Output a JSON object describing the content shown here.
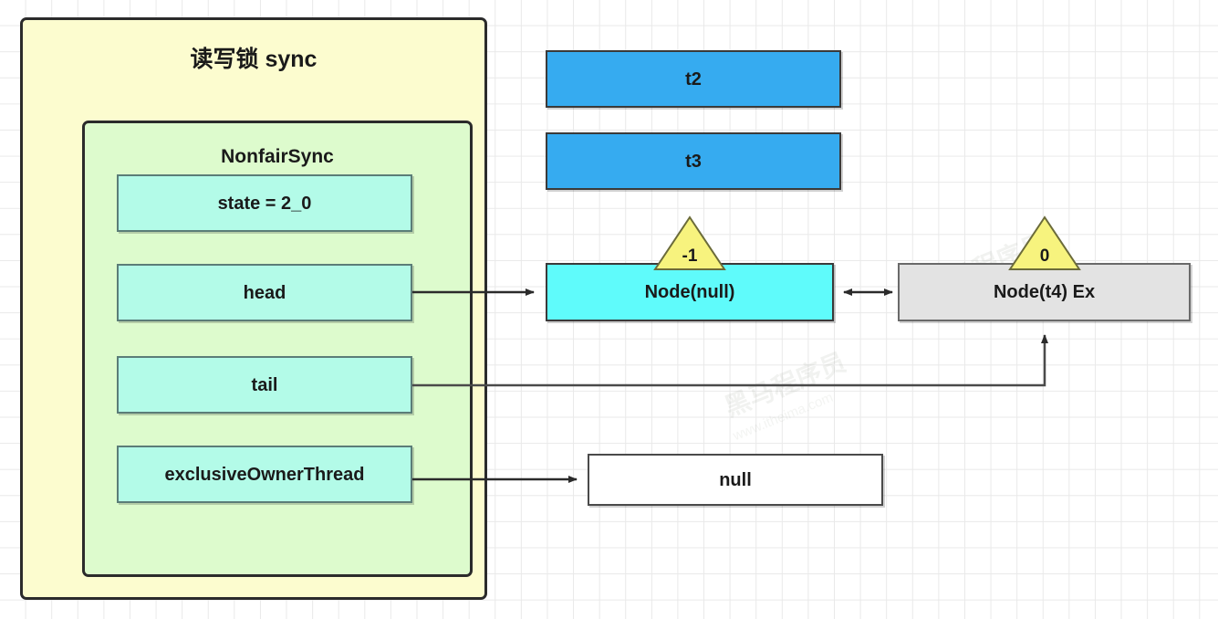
{
  "diagram": {
    "title": "读写锁 sync",
    "inner_title": "NonfairSync",
    "fields": [
      {
        "label": "state = 2_0"
      },
      {
        "label": "head"
      },
      {
        "label": "tail"
      },
      {
        "label": "exclusiveOwnerThread"
      }
    ],
    "threads": [
      {
        "label": "t2"
      },
      {
        "label": "t3"
      }
    ],
    "nodes": [
      {
        "label": "Node(null)",
        "wait_status": "-1"
      },
      {
        "label": "Node(t4) Ex",
        "wait_status": "0"
      }
    ],
    "owner_value": "null",
    "colors": {
      "outer_fill": "#fcfccf",
      "inner_fill": "#ddfbcd",
      "field_fill": "#b3fbe8",
      "thread_fill": "#36abf0",
      "head_node_fill": "#5ffbfb",
      "queued_node_fill": "#e3e3e3",
      "triangle_fill": "#f7f37e",
      "null_fill": "#ffffff",
      "stroke": "#2b2b2b",
      "grid": "#e9e9e9"
    },
    "watermarks": [
      {
        "text": "黑马程序员"
      },
      {
        "text": "www.itheima.com"
      }
    ]
  }
}
